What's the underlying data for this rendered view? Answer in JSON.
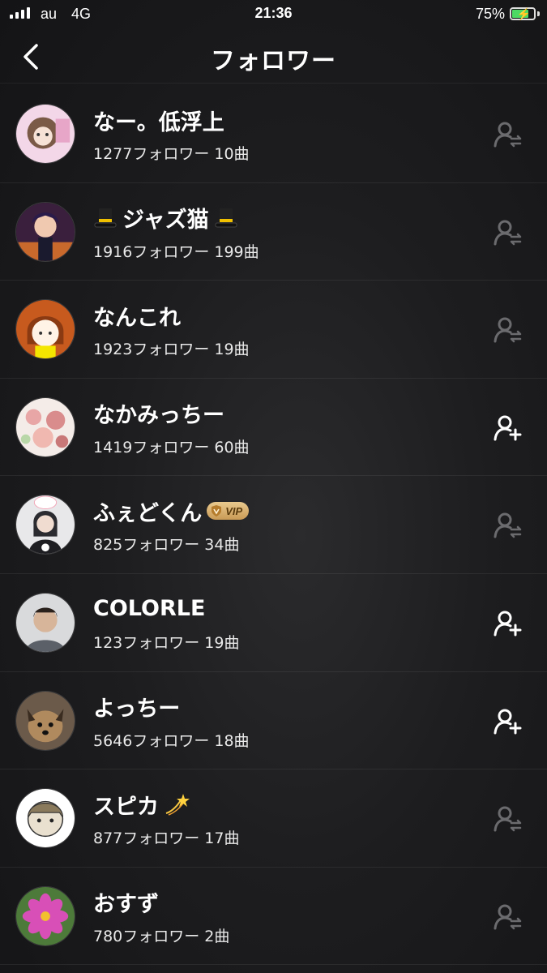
{
  "status_bar": {
    "carrier": "au",
    "network": "4G",
    "time": "21:36",
    "battery_percent": "75%",
    "battery_level": 0.75
  },
  "header": {
    "title": "フォロワー",
    "back_icon": "chevron-left-icon"
  },
  "users": [
    {
      "name": "なー。低浮上",
      "followers": "1277フォロワー",
      "songs": "10曲",
      "follow_state": "mutual",
      "follow_icon": "user-mutual-icon"
    },
    {
      "name": "ジャズ猫",
      "followers": "1916フォロワー",
      "songs": "199曲",
      "follow_state": "mutual",
      "follow_icon": "user-mutual-icon",
      "decor": "top-hat-emoji"
    },
    {
      "name": "なんこれ",
      "followers": "1923フォロワー",
      "songs": "19曲",
      "follow_state": "mutual",
      "follow_icon": "user-mutual-icon"
    },
    {
      "name": "なかみっちー",
      "followers": "1419フォロワー",
      "songs": "60曲",
      "follow_state": "follow",
      "follow_icon": "user-add-icon"
    },
    {
      "name": "ふぇどくん",
      "followers": "825フォロワー",
      "songs": "34曲",
      "follow_state": "mutual",
      "follow_icon": "user-mutual-icon",
      "badge": "VIP"
    },
    {
      "name": "COLORLE",
      "followers": "123フォロワー",
      "songs": "19曲",
      "follow_state": "follow",
      "follow_icon": "user-add-icon"
    },
    {
      "name": "よっちー",
      "followers": "5646フォロワー",
      "songs": "18曲",
      "follow_state": "follow",
      "follow_icon": "user-add-icon"
    },
    {
      "name": "スピカ",
      "followers": "877フォロワー",
      "songs": "17曲",
      "follow_state": "mutual",
      "follow_icon": "user-mutual-icon",
      "decor": "dizzy-star-emoji"
    },
    {
      "name": "おすず",
      "followers": "780フォロワー",
      "songs": "2曲",
      "follow_state": "mutual",
      "follow_icon": "user-mutual-icon"
    }
  ],
  "colors": {
    "background": "#1d1d1f",
    "text": "#ffffff",
    "mutual_icon": "#6b6b6e",
    "follow_icon": "#ffffff",
    "vip_gold": "#d9b06e",
    "battery_green": "#4cd964"
  }
}
